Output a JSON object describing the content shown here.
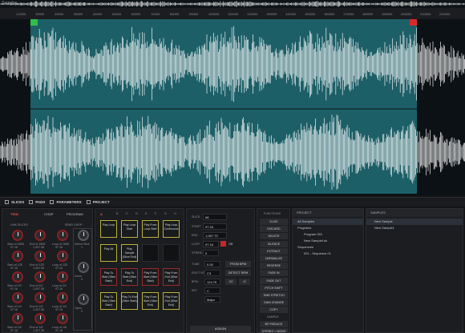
{
  "waveform": {
    "sample_name": "Samples",
    "ruler_ticks": [
      "1,0000",
      "10000",
      "20000",
      "30000",
      "40000",
      "50000",
      "60000",
      "70000",
      "80000",
      "90000",
      "100000",
      "110000",
      "120000",
      "130000",
      "140000",
      "150000",
      "160000",
      "170000",
      "180000",
      "190000",
      "200000",
      "210000",
      "220000"
    ],
    "start_marker_color": "#2fbf4a",
    "end_marker_color": "#d92a2a",
    "region_color": "#1d5f67",
    "wave_color": "#ffffff",
    "playhead_marker_color": "#ffffff"
  },
  "tabs": [
    "SLICES",
    "PADS",
    "PARAMETERS",
    "PROJECT"
  ],
  "trim": {
    "modes": [
      "TRIM",
      "CHOP",
      "PROGRAM"
    ],
    "sub_labels": [
      "LINK SLICES",
      "SEND CHOP"
    ],
    "knobs": [
      {
        "label": "Start of 1808",
        "value": "97.16"
      },
      {
        "label": "End of 1808",
        "value": "1,007.38"
      },
      {
        "label": "Loop of 1808",
        "value": "97.16"
      },
      {
        "label": "Select Slice",
        "value": "1"
      },
      {
        "label": "Start of 1ZE",
        "value": "97.16"
      },
      {
        "label": "End of 1ZE",
        "value": "1,001.06"
      },
      {
        "label": "Loop of 1ZE",
        "value": "97.16"
      },
      {
        "label": "Start of 2/2",
        "value": "97.16"
      },
      {
        "label": "End of 2/2",
        "value": "1,007.38"
      },
      {
        "label": "Loop of 2/2",
        "value": "97.16"
      },
      {
        "label": "Start of 1/4",
        "value": "97.16"
      },
      {
        "label": "End of 1/4",
        "value": "1,007.38"
      },
      {
        "label": "Loop of 1/4",
        "value": "97.16"
      },
      {
        "label": "Start of 1/8",
        "value": "97.16"
      },
      {
        "label": "End of 1/8",
        "value": "1,007.38"
      },
      {
        "label": "Loop of 1/8",
        "value": "97.16"
      }
    ],
    "right_column": [
      {
        "label": "Select Slice",
        "value": "1"
      },
      {
        "label": "Zoom",
        "value": "0"
      },
      {
        "label": "Open",
        "value": "0"
      }
    ]
  },
  "pads": {
    "bank": "A",
    "bank_letters": [
      "A",
      "B",
      "C",
      "D",
      "E",
      "F",
      "G",
      "H"
    ],
    "grid": [
      [
        {
          "t": "Play Loop",
          "c": "y"
        },
        {
          "t": "Play Loop Start",
          "c": "y"
        },
        {
          "t": "Play From Loop Start",
          "c": "y"
        },
        {
          "t": "Play Loop Continuous",
          "c": "y"
        }
      ],
      [
        {
          "t": "Play All",
          "c": "y"
        },
        {
          "t": "Play Sample (Slice End)",
          "c": "y"
        },
        {
          "t": "",
          "c": "d"
        },
        {
          "t": "",
          "c": "d"
        }
      ],
      [
        {
          "t": "Play To Start (Slice Start)",
          "c": "r"
        },
        {
          "t": "Play To Start (Slice End)",
          "c": "r"
        },
        {
          "t": "Play From Start (Slice Start)",
          "c": "r"
        },
        {
          "t": "Play From End (Slice End)",
          "c": "r"
        }
      ],
      [
        {
          "t": "Play To Start (Slice Start)",
          "c": "y"
        },
        {
          "t": "Play To End (Slice Start)",
          "c": "y"
        },
        {
          "t": "Play From Start (Slice End)",
          "c": "y"
        },
        {
          "t": "Play From End (Slice End)",
          "c": "y"
        }
      ]
    ]
  },
  "params": {
    "slice": "#8",
    "start": "97.16",
    "end": "1,067.79",
    "loop": "97.16",
    "loop_state": "Off",
    "stride": "0",
    "tune": "0.00",
    "root": "C3",
    "bpm": "124.75",
    "key": "C",
    "scale": "Major",
    "from_bpm": "FROM BPM",
    "detect_bpm": "DETECT BPM",
    "bpm_btns": [
      "X2",
      "/2"
    ],
    "assign": "ASSIGN"
  },
  "functions": {
    "header": "FUNCTIONS",
    "items": [
      "SLICE",
      "DISCARD",
      "DELETE",
      "SILENCE",
      "EXTRACT",
      "NORMALIZE",
      "REVERSE",
      "FADE IN",
      "FADE OUT",
      "PITCH SHIFT",
      "TIME STRETCH",
      "GAIN CHANGE",
      "COPY"
    ],
    "footer": [
      "SAMPLE",
      "BIT REDUCE",
      "STEREO > MONO"
    ]
  },
  "project": {
    "header": "PROJECT",
    "items": [
      {
        "t": "All Samples",
        "lvl": 0,
        "sel": true
      },
      {
        "t": "Programs",
        "lvl": 0
      },
      {
        "t": "Program 001",
        "lvl": 1
      },
      {
        "t": "New Sample1ok",
        "lvl": 1
      },
      {
        "t": "Sequences",
        "lvl": 0
      },
      {
        "t": "001 - Sequence 01",
        "lvl": 1
      }
    ]
  },
  "samples": {
    "header": "SAMPLES",
    "items": [
      "New Sample",
      "New Sample1"
    ]
  }
}
